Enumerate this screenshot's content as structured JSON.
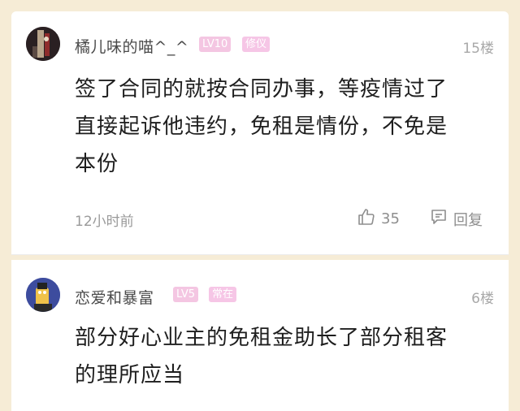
{
  "comments": [
    {
      "username": "橘儿味的喵^_^",
      "level": "LV10",
      "tag": "修仪",
      "floor": "15楼",
      "content_lines": [
        "签了合同的就按合同办事，等疫情过了",
        "直接起诉他违约，免租是情份，不免是",
        "本份"
      ],
      "time": "12小时前",
      "likes": "35",
      "reply_label": "回复",
      "avatar_icon": "portrait-avatar-icon"
    },
    {
      "username": "恋爱和暴富",
      "level": "LV5",
      "tag": "常在",
      "floor": "6楼",
      "content_lines": [
        "部分好心业主的免租金助长了部分租客",
        "的理所应当"
      ],
      "avatar_icon": "cartoon-avatar-icon"
    }
  ],
  "colors": {
    "background": "#f6ecd6",
    "card": "#ffffff",
    "badge": "#f4c6e2"
  }
}
